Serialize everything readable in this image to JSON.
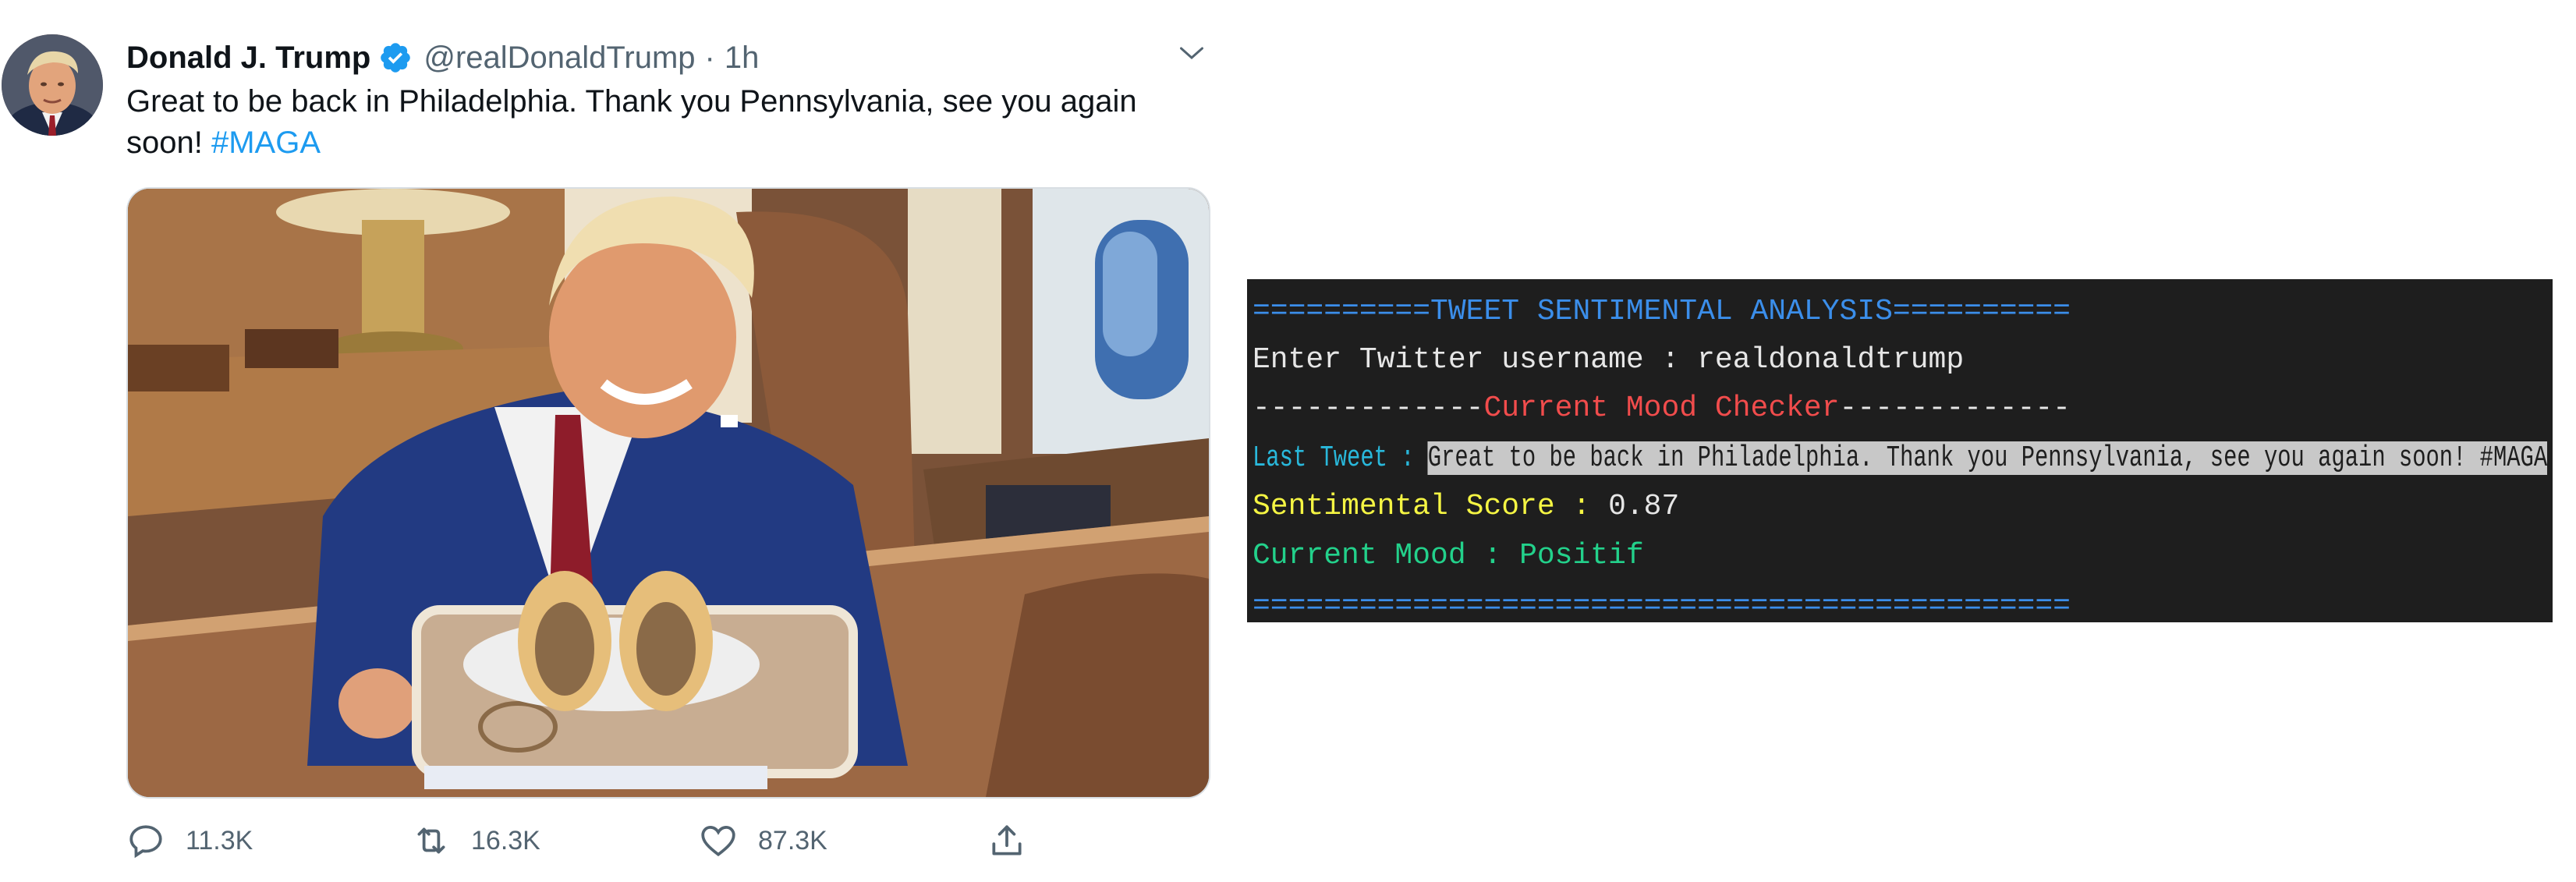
{
  "tweet": {
    "display_name": "Donald J. Trump",
    "handle": "@realDonaldTrump",
    "separator": "·",
    "time": "1h",
    "text_main": "Great to be back in Philadelphia. Thank you Pennsylvania, see you again soon! ",
    "hashtag": "#MAGA",
    "verified_icon": "verified-badge-icon",
    "colors": {
      "accent": "#1d9bf0",
      "text": "#0f1419",
      "muted": "#536471"
    },
    "actions": {
      "reply_count": "11.3K",
      "retweet_count": "16.3K",
      "like_count": "87.3K"
    }
  },
  "terminal": {
    "title_line": "==========TWEET SENTIMENTAL ANALYSIS==========",
    "username_prompt": "Enter Twitter username : ",
    "username_value": "realdonaldtrump",
    "mood_rule_left": "-------------",
    "mood_title": "Current Mood Checker",
    "mood_rule_right": "-------------",
    "last_tweet_label": "Last Tweet : ",
    "last_tweet_value": "Great to be back in Philadelphia. Thank you Pennsylvania, see you again soon! #MAGA",
    "score_label": "Sentimental Score : ",
    "score_value": "0.87",
    "mood_label": "Current Mood : ",
    "mood_value": "Positif",
    "footer_line": "==============================================",
    "colors": {
      "background": "#1e1e1e",
      "blue": "#3b8eea",
      "red": "#f14c4c",
      "cyan": "#29b8db",
      "yellow": "#f5f543",
      "green": "#23d18b",
      "highlight": "#c8c8c8"
    }
  }
}
